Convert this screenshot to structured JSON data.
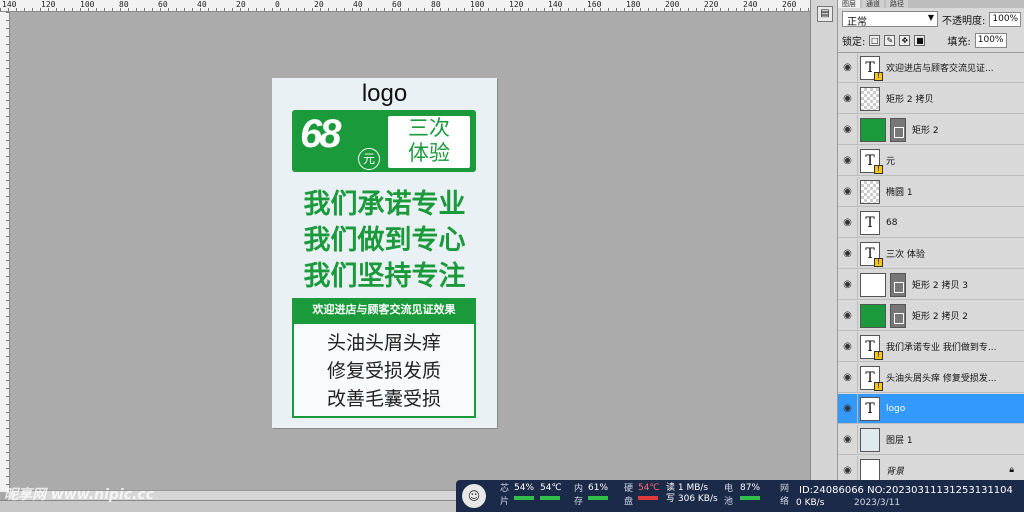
{
  "ruler": {
    "ticks": [
      "140",
      "120",
      "100",
      "80",
      "60",
      "40",
      "20",
      "0",
      "20",
      "40",
      "60",
      "80",
      "100",
      "120",
      "140",
      "160",
      "180",
      "200",
      "220",
      "240",
      "260"
    ]
  },
  "panel": {
    "tabs": [
      "图层",
      "通道",
      "路径"
    ],
    "blend_mode": "正常",
    "opacity_label": "不透明度:",
    "opacity_value": "100%",
    "lock_label": "锁定:",
    "fill_label": "填充:",
    "fill_value": "100%"
  },
  "layers": [
    {
      "name": "欢迎进店与顾客交流见证...",
      "kind": "text",
      "warn": true
    },
    {
      "name": "矩形 2 拷贝",
      "kind": "checker",
      "warn": false
    },
    {
      "name": "矩形 2",
      "kind": "green-mask",
      "warn": false
    },
    {
      "name": "元",
      "kind": "text",
      "warn": true
    },
    {
      "name": "椭圆 1",
      "kind": "checker",
      "warn": false
    },
    {
      "name": "68",
      "kind": "text",
      "warn": false
    },
    {
      "name": "三次 体验",
      "kind": "text",
      "warn": true
    },
    {
      "name": "矩形 2 拷贝 3",
      "kind": "white-mask",
      "warn": false
    },
    {
      "name": "矩形 2 拷贝 2",
      "kind": "green-mask",
      "warn": false
    },
    {
      "name": "我们承诺专业 我们做到专...",
      "kind": "text",
      "warn": true
    },
    {
      "name": "头油头屑头痒 修复受损发...",
      "kind": "text",
      "warn": true
    },
    {
      "name": "logo",
      "kind": "text",
      "warn": false,
      "selected": true
    },
    {
      "name": "图层 1",
      "kind": "image",
      "warn": false
    },
    {
      "name": "背景",
      "kind": "background",
      "warn": false
    }
  ],
  "document": {
    "logo": "logo",
    "price": "68",
    "price_unit": "元",
    "offer_line1": "三次",
    "offer_line2": "体验",
    "slogans": [
      "我们承诺专业",
      "我们做到专心",
      "我们坚持专注"
    ],
    "invite": "欢迎进店与顾客交流见证效果",
    "effects": [
      "头油头屑头痒",
      "修复受损发质",
      "改善毛囊受损"
    ]
  },
  "colors": {
    "brand_green": "#1a9a3a",
    "selection_blue": "#3399ff",
    "tray_bg": "#1c2a4a"
  },
  "watermark": "昵享网 www.nipic.cc",
  "tray": {
    "cpu_label": "芯片",
    "cpu_usage": "54%",
    "cpu_temp": "54℃",
    "mem_label": "内存",
    "mem_usage": "61%",
    "disk_label": "硬盘",
    "disk_temp": "54℃",
    "read": "读 1 MB/s",
    "write": "写 306 KB/s",
    "battery_label": "电池",
    "battery": "87%",
    "net_label": "网络",
    "net_speed": "0 KB/s",
    "id": "ID:24086066 NO:20230311131253131104",
    "date": "2023/3/11"
  }
}
